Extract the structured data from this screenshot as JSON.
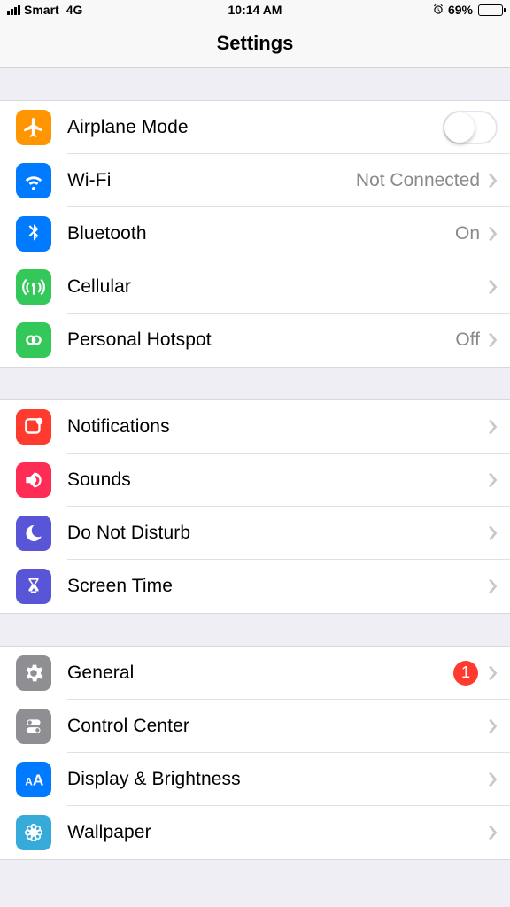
{
  "status": {
    "carrier": "Smart",
    "network": "4G",
    "time": "10:14 AM",
    "battery_pct": "69%"
  },
  "nav": {
    "title": "Settings"
  },
  "sections": [
    {
      "rows": [
        {
          "label": "Airplane Mode"
        },
        {
          "label": "Wi-Fi",
          "value": "Not Connected"
        },
        {
          "label": "Bluetooth",
          "value": "On"
        },
        {
          "label": "Cellular"
        },
        {
          "label": "Personal Hotspot",
          "value": "Off"
        }
      ]
    },
    {
      "rows": [
        {
          "label": "Notifications"
        },
        {
          "label": "Sounds"
        },
        {
          "label": "Do Not Disturb"
        },
        {
          "label": "Screen Time"
        }
      ]
    },
    {
      "rows": [
        {
          "label": "General",
          "badge": "1"
        },
        {
          "label": "Control Center"
        },
        {
          "label": "Display & Brightness"
        },
        {
          "label": "Wallpaper"
        }
      ]
    }
  ],
  "colors": {
    "orange": "#ff9500",
    "blue": "#007aff",
    "green": "#34c759",
    "green2": "#34c759",
    "red": "#ff3b30",
    "pink": "#ff2d55",
    "indigo": "#5856d6",
    "gray": "#8e8e93",
    "cyan": "#36aad9"
  }
}
